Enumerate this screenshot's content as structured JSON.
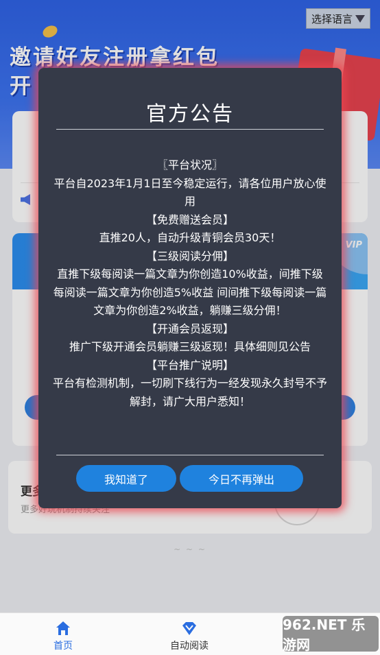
{
  "language_selector": {
    "label": "选择语言"
  },
  "banner": {
    "title": "邀请好友注册拿红包",
    "subtitle": "开"
  },
  "card3": {
    "title": "更多",
    "subtitle": "更多好玩机制持续关注"
  },
  "modal": {
    "title": "官方公告",
    "lines": [
      "〖平台状况〗",
      "平台自2023年1月1日至今稳定运行，请各位用户放心使用",
      "【免费赠送会员】",
      "直推20人，自动升级青铜会员30天！",
      "【三级阅读分佣】",
      "直推下级每阅读一篇文章为你创造10%收益，间推下级每阅读一篇文章为你创造5%收益 间间推下级每阅读一篇文章为你创造2%收益，躺赚三级分佣！",
      "【开通会员返现】",
      "推广下级开通会员躺赚三级返现！具体细则见公告",
      "【平台推广说明】",
      "平台有检测机制，一切刷下线行为一经发现永久封号不予解封，请广大用户悉知！"
    ],
    "btn_ok": "我知道了",
    "btn_dismiss": "今日不再弹出"
  },
  "tabbar": {
    "home": "首页",
    "read": "自动阅读"
  },
  "watermark": {
    "text": "962.NET 乐游网"
  },
  "colors": {
    "accent": "#1f82de",
    "modal_bg": "#353a48",
    "glow": "#eb4650",
    "banner": "#2f63e6"
  }
}
